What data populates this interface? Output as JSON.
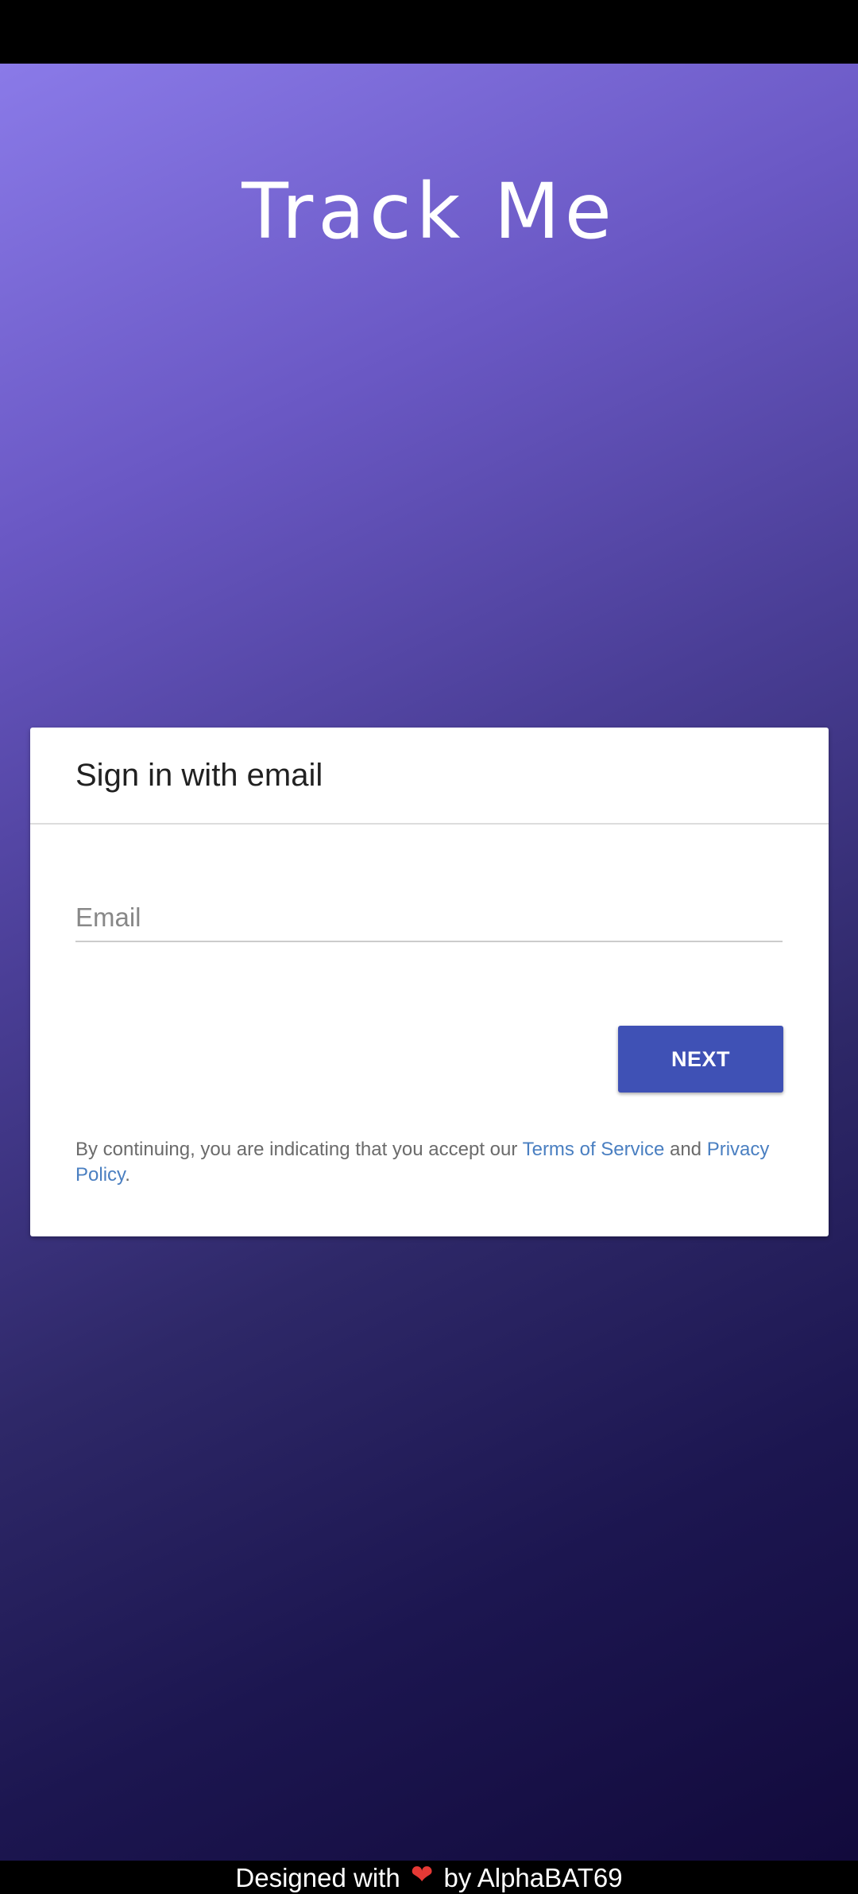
{
  "app": {
    "title": "Track Me"
  },
  "signin_card": {
    "title": "Sign in with email",
    "email_placeholder": "Email",
    "email_value": "",
    "next_label": "NEXT",
    "terms_prefix": "By continuing, you are indicating that you accept our ",
    "terms_link": "Terms of Service",
    "terms_middle": " and ",
    "privacy_link": "Privacy Policy",
    "terms_suffix": "."
  },
  "footer": {
    "prefix": "Designed with",
    "heart_icon": "heart-icon",
    "suffix": "by AlphaBAT69"
  },
  "colors": {
    "primary_button": "#3f51b5",
    "link": "#4a7fc1",
    "heart": "#e53935",
    "gradient_start": "#8a7ae8",
    "gradient_end": "#120a3c"
  }
}
